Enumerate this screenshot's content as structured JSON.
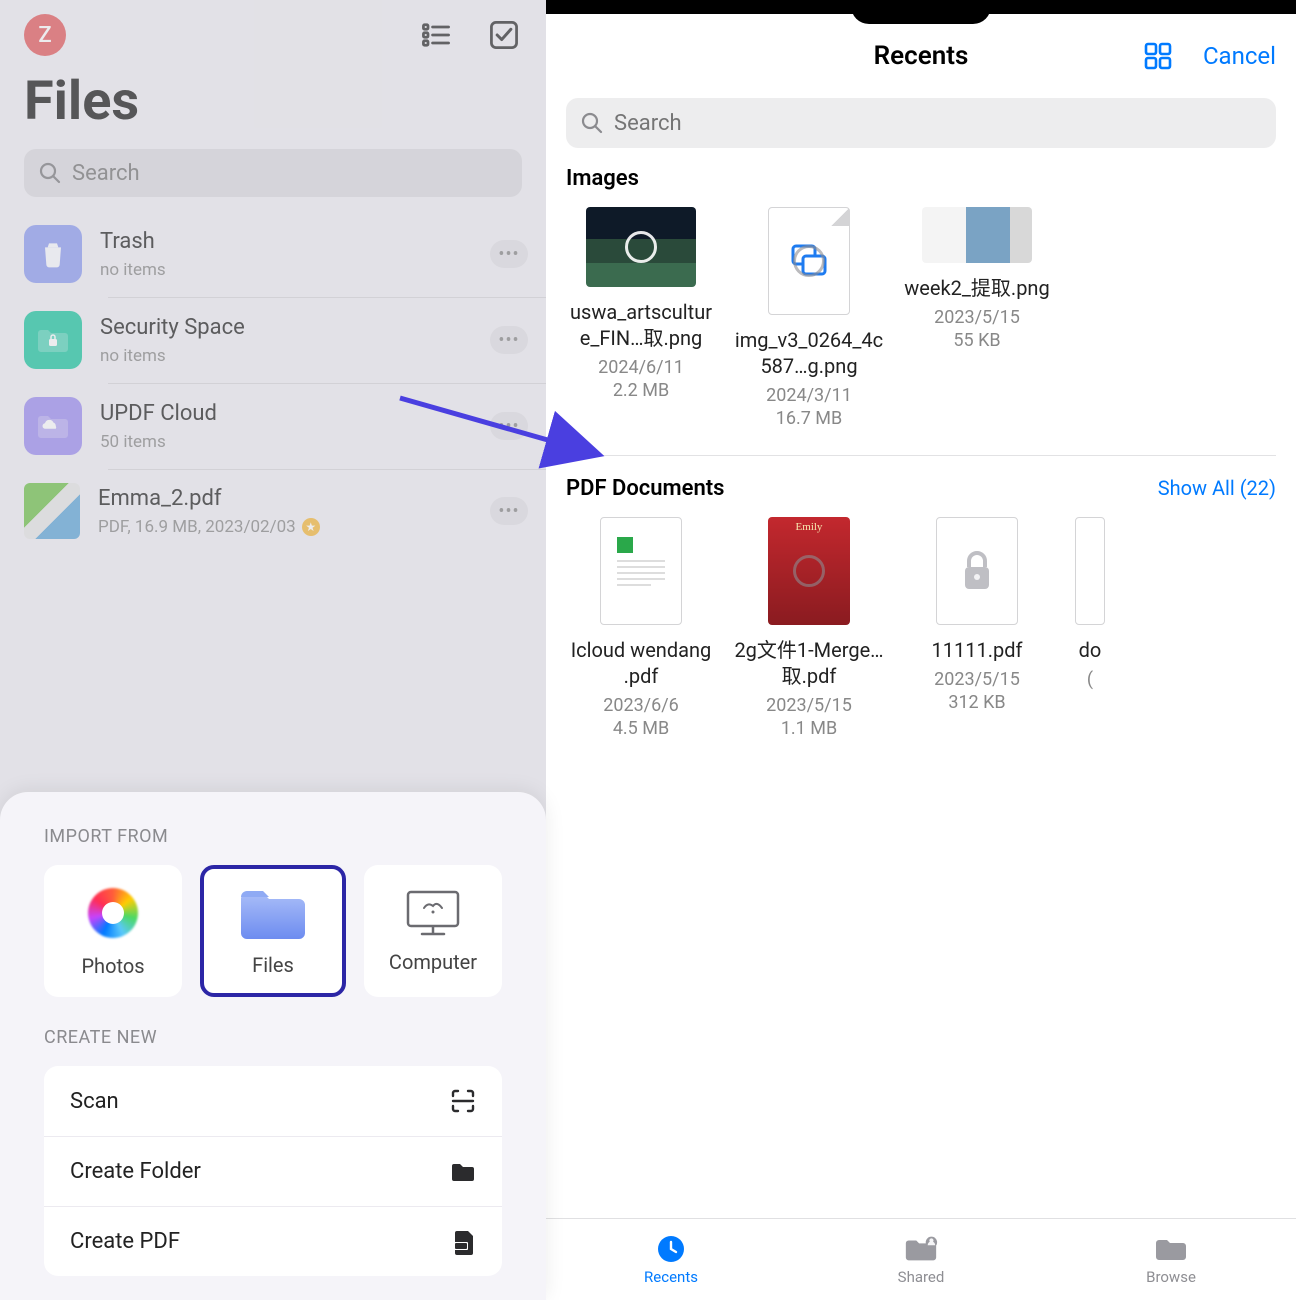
{
  "left": {
    "avatar_initial": "Z",
    "title": "Files",
    "search_placeholder": "Search",
    "items": [
      {
        "name": "Trash",
        "meta": "no items",
        "kind": "trash"
      },
      {
        "name": "Security Space",
        "meta": "no items",
        "kind": "security"
      },
      {
        "name": "UPDF Cloud",
        "meta": "50 items",
        "kind": "cloud"
      },
      {
        "name": "Emma_2.pdf",
        "meta": "PDF, 16.9 MB, 2023/02/03",
        "kind": "pdf",
        "starred": true
      }
    ]
  },
  "sheet": {
    "import_label": "IMPORT FROM",
    "import_options": [
      {
        "label": "Photos"
      },
      {
        "label": "Files"
      },
      {
        "label": "Computer"
      }
    ],
    "create_label": "CREATE NEW",
    "create_options": [
      {
        "label": "Scan"
      },
      {
        "label": "Create Folder"
      },
      {
        "label": "Create PDF"
      }
    ]
  },
  "right": {
    "title": "Recents",
    "cancel": "Cancel",
    "search_placeholder": "Search",
    "sections": {
      "images": {
        "title": "Images",
        "items": [
          {
            "name": "uswa_artsculture_FIN…取.png",
            "date": "2024/6/11",
            "size": "2.2 MB",
            "thumb": "photo"
          },
          {
            "name": "img_v3_0264_4c587…g.png",
            "date": "2024/3/11",
            "size": "16.7 MB",
            "thumb": "doc"
          },
          {
            "name": "week2_提取.png",
            "date": "2023/5/15",
            "size": "55 KB",
            "thumb": "photo2"
          }
        ]
      },
      "pdfs": {
        "title": "PDF Documents",
        "show_all": "Show All (22)",
        "items": [
          {
            "name": "Icloud wendang .pdf",
            "date": "2023/6/6",
            "size": "4.5 MB",
            "thumb": "doc"
          },
          {
            "name": "2g文件1-Merge…取.pdf",
            "date": "2023/5/15",
            "size": "1.1 MB",
            "thumb": "emily"
          },
          {
            "name": "11111.pdf",
            "date": "2023/5/15",
            "size": "312 KB",
            "thumb": "lock"
          },
          {
            "name": "do",
            "date": "(",
            "size": "",
            "thumb": "cut"
          }
        ]
      }
    },
    "tabs": [
      {
        "label": "Recents",
        "active": true
      },
      {
        "label": "Shared",
        "active": false
      },
      {
        "label": "Browse",
        "active": false
      }
    ]
  }
}
